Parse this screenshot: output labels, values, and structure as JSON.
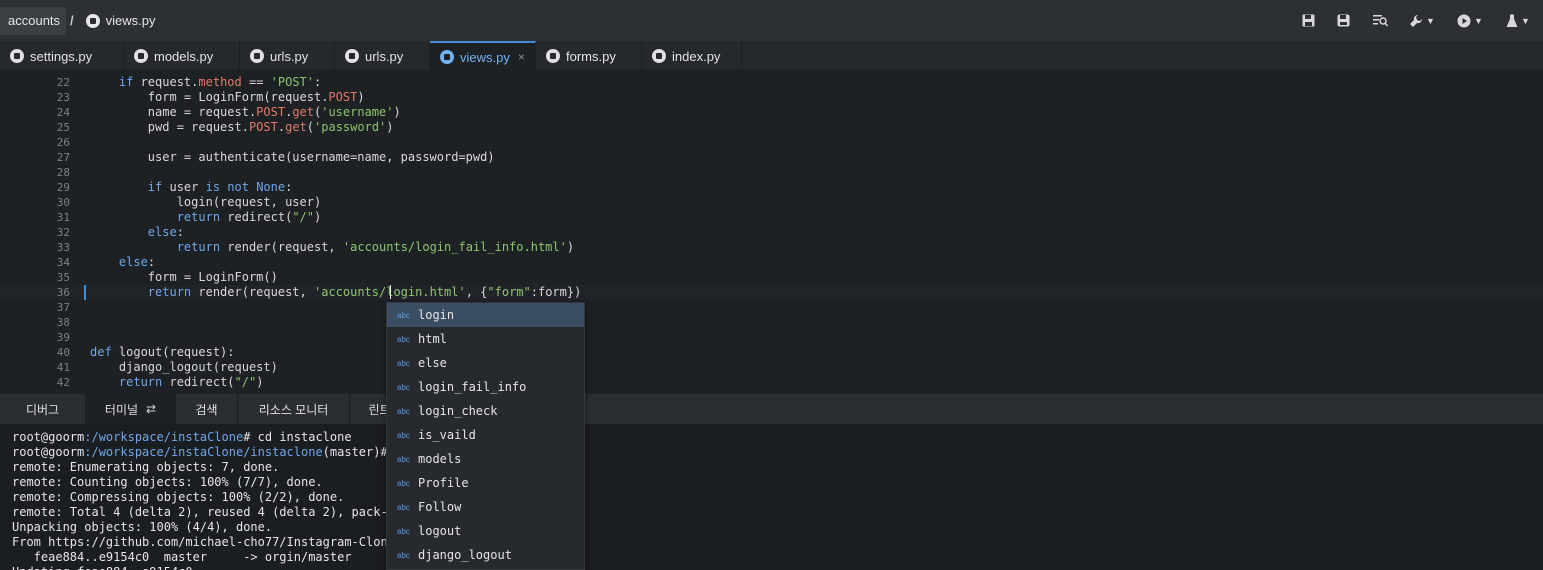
{
  "breadcrumb": {
    "folder": "accounts",
    "separator": "/",
    "file": "views.py"
  },
  "toolbar": [
    "save-icon",
    "save-all-icon",
    "find-icon",
    "wrench-icon",
    "run-icon",
    "flask-icon"
  ],
  "tabs": [
    {
      "label": "settings.py"
    },
    {
      "label": "models.py"
    },
    {
      "label": "urls.py"
    },
    {
      "label": "urls.py"
    },
    {
      "label": "views.py",
      "active": true,
      "close": "×"
    },
    {
      "label": "forms.py"
    },
    {
      "label": "index.py"
    }
  ],
  "editor": {
    "lines": [
      {
        "n": "22",
        "html": "    <span class='kw'>if</span> request.<span class='attr'>method</span> == <span class='str'>'POST'</span>:"
      },
      {
        "n": "23",
        "html": "        form = LoginForm(request.<span class='attr'>POST</span>)"
      },
      {
        "n": "24",
        "html": "        name = request.<span class='attr'>POST</span>.<span class='attr'>get</span>(<span class='str'>'username'</span>)"
      },
      {
        "n": "25",
        "html": "        pwd = request.<span class='attr'>POST</span>.<span class='attr'>get</span>(<span class='str'>'password'</span>)"
      },
      {
        "n": "26",
        "html": ""
      },
      {
        "n": "27",
        "html": "        user = authenticate(username=name, password=pwd)"
      },
      {
        "n": "28",
        "html": ""
      },
      {
        "n": "29",
        "html": "        <span class='kw'>if</span> user <span class='kw'>is not</span> <span class='kw'>None</span>:"
      },
      {
        "n": "30",
        "html": "            login(request, user)"
      },
      {
        "n": "31",
        "html": "            <span class='kw'>return</span> redirect(<span class='str'>\"/\"</span>)"
      },
      {
        "n": "32",
        "html": "        <span class='kw'>else</span>:"
      },
      {
        "n": "33",
        "html": "            <span class='kw'>return</span> render(request, <span class='str'>'accounts/login_fail_info.html'</span>)"
      },
      {
        "n": "34",
        "html": "    <span class='kw'>else</span>:"
      },
      {
        "n": "35",
        "html": "        form = LoginForm()"
      },
      {
        "n": "36",
        "html": "        <span class='kw'>return</span> render(request, <span class='str'>'accounts/login.html'</span>, {<span class='str'>\"form\"</span>:form})",
        "current": true
      },
      {
        "n": "37",
        "html": ""
      },
      {
        "n": "38",
        "html": ""
      },
      {
        "n": "39",
        "html": ""
      },
      {
        "n": "40",
        "html": "<span class='kw'>def</span> logout(request):"
      },
      {
        "n": "41",
        "html": "    django_logout(request)"
      },
      {
        "n": "42",
        "html": "    <span class='kw'>return</span> redirect(<span class='str'>\"/\"</span>)"
      }
    ]
  },
  "panel_tabs": [
    {
      "label": "디버그"
    },
    {
      "label": "터미널",
      "active": true
    },
    {
      "label": "검색"
    },
    {
      "label": "리소스 모니터"
    },
    {
      "label": "린트"
    }
  ],
  "terminal": {
    "lines": [
      {
        "prompt": "root@goorm",
        "path": ":/workspace/instaClone",
        "rest": "# cd instaclone"
      },
      {
        "prompt": "root@goorm",
        "path": ":/workspace/instaClone/instaclone",
        "rest": "(master)#"
      },
      {
        "text": "remote: Enumerating objects: 7, done."
      },
      {
        "text": "remote: Counting objects: 100% (7/7), done."
      },
      {
        "text": "remote: Compressing objects: 100% (2/2), done."
      },
      {
        "text": "remote: Total 4 (delta 2), reused 4 (delta 2), pack-"
      },
      {
        "text": "Unpacking objects: 100% (4/4), done."
      },
      {
        "text": "From https://github.com/michael-cho77/Instagram-Clon"
      },
      {
        "text": "   feae884..e9154c0  master     -> orgin/master"
      },
      {
        "text": "Updating feae884..e9154c0"
      }
    ]
  },
  "autocomplete": {
    "tag": "abc",
    "items": [
      "login",
      "html",
      "else",
      "login_fail_info",
      "login_check",
      "is_vaild",
      "models",
      "Profile",
      "Follow",
      "logout",
      "django_logout"
    ]
  }
}
